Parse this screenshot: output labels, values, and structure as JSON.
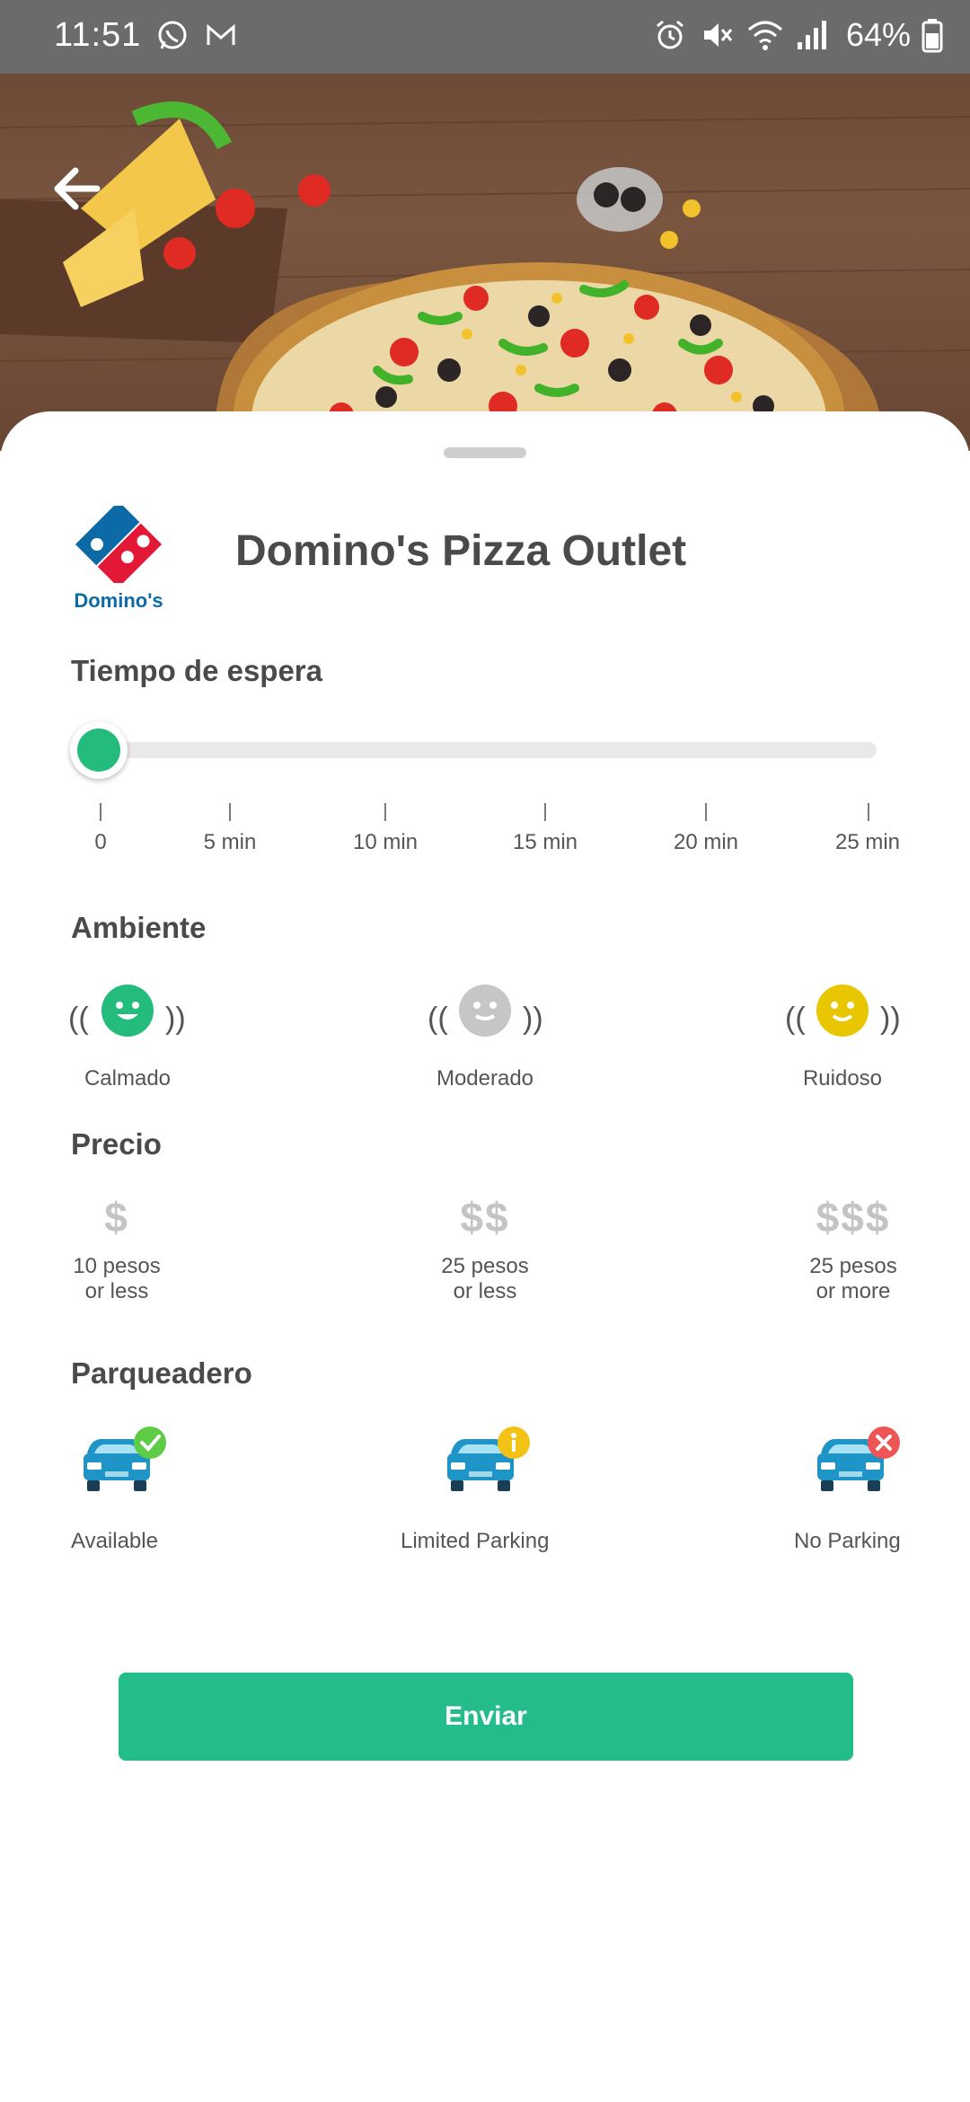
{
  "status_bar": {
    "time": "11:51",
    "battery": "64%",
    "left_icons": [
      "whatsapp-icon",
      "gmail-icon"
    ],
    "right_icons": [
      "alarm-icon",
      "mute-icon",
      "wifi-icon",
      "signal-icon",
      "battery-icon"
    ]
  },
  "restaurant": {
    "name": "Domino's Pizza Outlet",
    "logo_text": "Domino's"
  },
  "wait_time": {
    "title": "Tiempo de espera",
    "selected_index": 0,
    "ticks": [
      "0",
      "5 min",
      "10 min",
      "15 min",
      "20 min",
      "25 min"
    ]
  },
  "ambient": {
    "title": "Ambiente",
    "options": [
      {
        "label": "Calmado",
        "color": "#23bc7c"
      },
      {
        "label": "Moderado",
        "color": "#c6c6c6"
      },
      {
        "label": "Ruidoso",
        "color": "#e8c600"
      }
    ]
  },
  "price": {
    "title": "Precio",
    "options": [
      {
        "symbol": "$",
        "line1": "10 pesos",
        "line2": "or less"
      },
      {
        "symbol": "$$",
        "line1": "25 pesos",
        "line2": "or less"
      },
      {
        "symbol": "$$$",
        "line1": "25 pesos",
        "line2": "or more"
      }
    ]
  },
  "parking": {
    "title": "Parqueadero",
    "options": [
      {
        "label": "Available",
        "badge": "check",
        "badge_color": "#5fcc46"
      },
      {
        "label": "Limited Parking",
        "badge": "info",
        "badge_color": "#f2c316"
      },
      {
        "label": "No Parking",
        "badge": "close",
        "badge_color": "#f05555"
      }
    ]
  },
  "submit_label": "Enviar",
  "colors": {
    "accent": "#23bc8a",
    "status_bar": "#6b6b6b",
    "car": "#1e95c6"
  }
}
